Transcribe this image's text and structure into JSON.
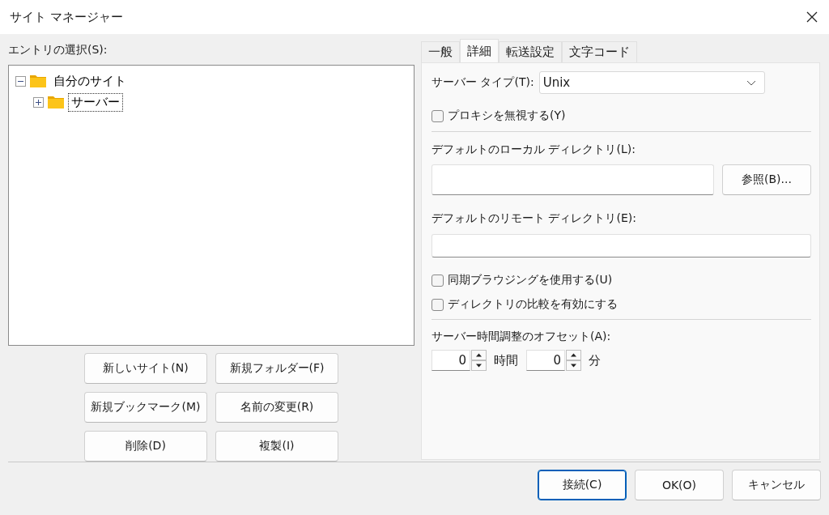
{
  "window": {
    "title": "サイト マネージャー"
  },
  "entries_label": "エントリの選択(S):",
  "tree": [
    {
      "label": "自分のサイト",
      "expanded": true,
      "selected": false,
      "children": [
        {
          "label": "サーバー",
          "expanded": false,
          "selected": true
        }
      ]
    }
  ],
  "site_buttons": [
    "新しいサイト(N)",
    "新規フォルダー(F)",
    "新規ブックマーク(M)",
    "名前の変更(R)",
    "削除(D)",
    "複製(I)"
  ],
  "tabs": [
    {
      "label": "一般",
      "selected": false
    },
    {
      "label": "詳細",
      "selected": true
    },
    {
      "label": "転送設定",
      "selected": false
    },
    {
      "label": "文字コード",
      "selected": false
    }
  ],
  "details": {
    "server_type": {
      "label": "サーバー タイプ(T):",
      "value": "Unix"
    },
    "bypass_proxy": {
      "label": "プロキシを無視する(Y)",
      "checked": false
    },
    "local_dir": {
      "label": "デフォルトのローカル ディレクトリ(L):",
      "browse_button": "参照(B)..."
    },
    "remote_dir": {
      "label": "デフォルトのリモート ディレクトリ(E):"
    },
    "sync_browsing": {
      "label": "同期ブラウジングを使用する(U)",
      "checked": false
    },
    "dir_compare": {
      "label": "ディレクトリの比較を有効にする",
      "checked": false
    },
    "time_offset": {
      "label": "サーバー時間調整のオフセット(A):",
      "hours": "0",
      "hours_unit": "時間",
      "minutes": "0",
      "minutes_unit": "分"
    }
  },
  "footer_buttons": [
    {
      "label": "接続(C)",
      "default": true
    },
    {
      "label": "OK(O)",
      "default": false
    },
    {
      "label": "キャンセル",
      "default": false
    }
  ]
}
